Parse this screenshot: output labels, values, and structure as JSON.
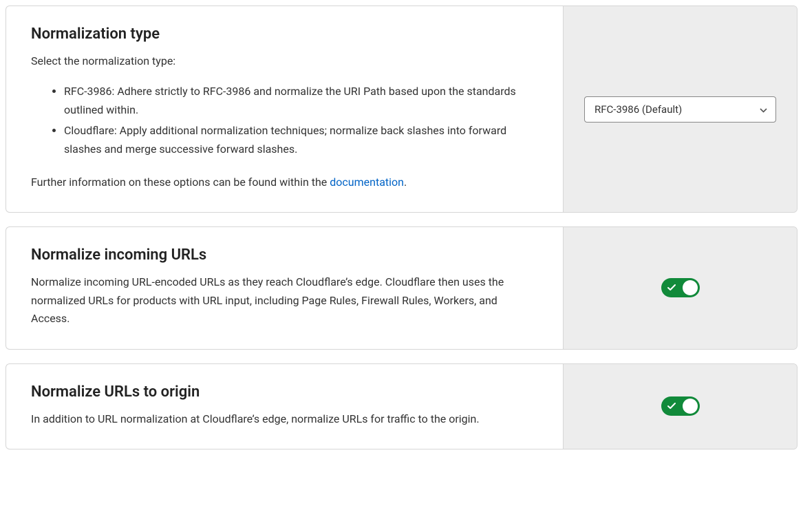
{
  "cards": {
    "normalization_type": {
      "title": "Normalization type",
      "intro": "Select the normalization type:",
      "bullets": [
        {
          "label": "RFC-3986:",
          "text": " Adhere strictly to RFC-3986 and normalize the URI Path based upon the standards outlined within."
        },
        {
          "label": "Cloudflare:",
          "text": " Apply additional normalization techniques; normalize back slashes into forward slashes and merge successive forward slashes."
        }
      ],
      "footer_pre": "Further information on these options can be found within the ",
      "footer_link": "documentation",
      "footer_post": ".",
      "select_value": "RFC-3986 (Default)"
    },
    "normalize_incoming": {
      "title": "Normalize incoming URLs",
      "desc": "Normalize incoming URL-encoded URLs as they reach Cloudflare’s edge. Cloudflare then uses the normalized URLs for products with URL input, including Page Rules, Firewall Rules, Workers, and Access.",
      "toggle_on": true
    },
    "normalize_origin": {
      "title": "Normalize URLs to origin",
      "desc": "In addition to URL normalization at Cloudflare’s edge, normalize URLs for traffic to the origin.",
      "toggle_on": true
    }
  }
}
